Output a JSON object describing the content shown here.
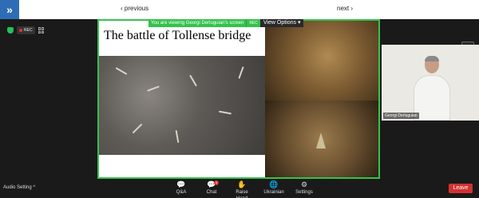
{
  "nav": {
    "prev_label": "‹ previous",
    "next_label": "next ›",
    "expand_icon": "double-chevron-right-icon"
  },
  "status": {
    "rec_label": "REC"
  },
  "share": {
    "viewing_label": "You are viewing Georgi Derluguian's screen",
    "rec_label": "REC",
    "view_options_label": "View Options ▾",
    "accent": "#35c24c"
  },
  "slide": {
    "title": "The battle of Tollense bridge"
  },
  "video": {
    "name": "Georgi Derluguian"
  },
  "toolbar": {
    "audio_setting_label": "Audio Setting ^",
    "items": [
      {
        "label": "Q&A",
        "icon": "qa-icon",
        "glyph": "💬"
      },
      {
        "label": "Chat",
        "icon": "chat-icon",
        "glyph": "💬",
        "badge": "3"
      },
      {
        "label": "Raise Hand",
        "icon": "hand-icon",
        "glyph": "✋"
      },
      {
        "label": "Ukrainian",
        "icon": "globe-icon",
        "glyph": "🌐"
      },
      {
        "label": "Settings",
        "icon": "gear-icon",
        "glyph": "⚙"
      }
    ],
    "leave_label": "Leave",
    "leave_color": "#d23232"
  }
}
